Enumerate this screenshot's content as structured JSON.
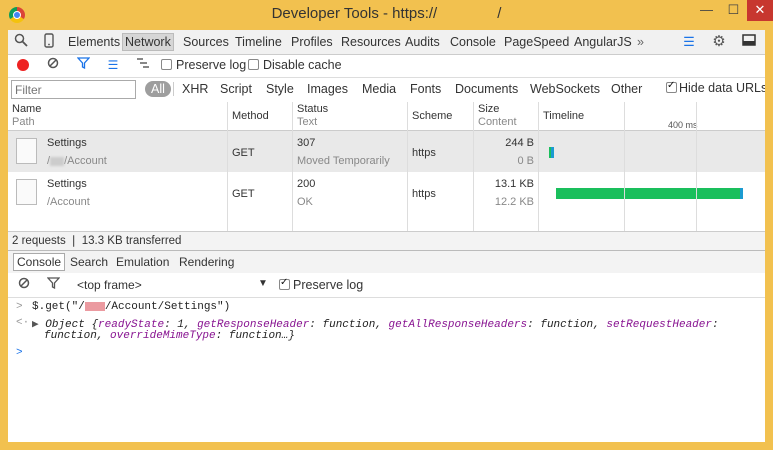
{
  "window": {
    "title": "Developer Tools - https://                    /",
    "minimize": "—",
    "maximize": "☐",
    "close": "✕"
  },
  "panel_tabs": [
    "Elements",
    "Network",
    "Sources",
    "Timeline",
    "Profiles",
    "Resources",
    "Audits",
    "Console",
    "PageSpeed",
    "AngularJS",
    "»"
  ],
  "toolbar": {
    "preserve_log": "Preserve log",
    "disable_cache": "Disable cache"
  },
  "filter": {
    "placeholder": "Filter",
    "types": [
      "All",
      "XHR",
      "Script",
      "Style",
      "Images",
      "Media",
      "Fonts",
      "Documents",
      "WebSockets",
      "Other"
    ],
    "hide_data_urls": "Hide data URLs"
  },
  "table": {
    "headers": {
      "name": "Name",
      "path": "Path",
      "method": "Method",
      "status": "Status",
      "text": "Text",
      "scheme": "Scheme",
      "size": "Size",
      "content": "Content",
      "timeline": "Timeline",
      "tick": "400 ms"
    },
    "rows": [
      {
        "name": "Settings",
        "path": "/Account",
        "method": "GET",
        "status": "307",
        "text": "Moved Temporarily",
        "scheme": "https",
        "size": "244 B",
        "content": "0 B"
      },
      {
        "name": "Settings",
        "path": "/Account",
        "method": "GET",
        "status": "200",
        "text": "OK",
        "scheme": "https",
        "size": "13.1 KB",
        "content": "12.2 KB"
      }
    ]
  },
  "summary": "2 requests ❘ 13.3 KB transferred",
  "drawer_tabs": [
    "Console",
    "Search",
    "Emulation",
    "Rendering"
  ],
  "console_toolbar": {
    "frame": "<top frame>",
    "preserve_log": "Preserve log"
  },
  "console": {
    "cmd_prefix": "$.get(\"/",
    "cmd_suffix": "/Account/Settings\")",
    "result_line1_prefix": "Object {",
    "p1": "readyState",
    "v1": ": 1, ",
    "p2": "getResponseHeader",
    "v2": ": function, ",
    "p3": "getAllResponseHeaders",
    "v3": ": function, ",
    "p4": "setRequestHeader",
    "v4": ":",
    "result_line2_prefix": "function, ",
    "p5": "overrideMimeType",
    "v5": ": function…}"
  },
  "colors": {
    "frame": "#f2c14f",
    "close": "#c7372f",
    "bar_green": "#1abf5c",
    "bar_blue": "#1b9bd1"
  }
}
